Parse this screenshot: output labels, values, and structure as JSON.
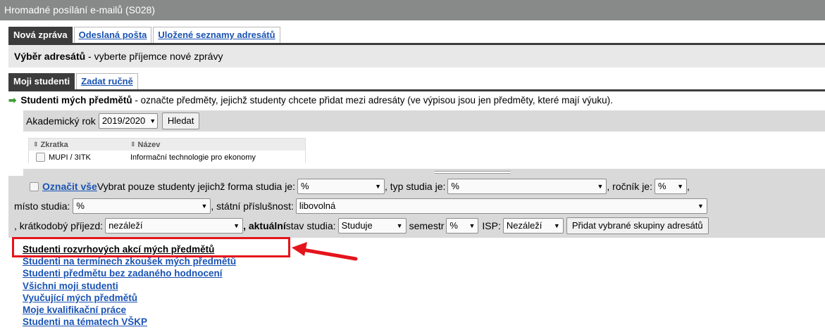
{
  "window": {
    "title": "Hromadné posílání e-mailů (S028)"
  },
  "main_tabs": [
    {
      "label": "Nová zpráva",
      "active": true
    },
    {
      "label": "Odeslaná pošta",
      "active": false
    },
    {
      "label": "Uložené seznamy adresátů",
      "active": false
    }
  ],
  "step": {
    "title": "Výběr adresátů",
    "description": " - vyberte příjemce nové zprávy"
  },
  "sub_tabs": [
    {
      "label": "Moji studenti",
      "active": true
    },
    {
      "label": "Zadat ručně",
      "active": false
    }
  ],
  "section": {
    "icon": "green-arrow-icon",
    "title": "Studenti mých předmětů",
    "description": " - označte předměty, jejichž studenty chcete přidat mezi adresáty (ve výpisou jsou jen předměty, které mají výuku)."
  },
  "academic_year": {
    "label": "Akademický rok",
    "value": "2019/2020",
    "button": "Hledat"
  },
  "subjects_table": {
    "columns": [
      "Zkratka",
      "Název"
    ],
    "rows": [
      {
        "code": "MUPI / 3ITK",
        "name": "Informační technologie pro ekonomy"
      }
    ]
  },
  "filters": {
    "select_all": "Označit vše",
    "text_form": " Vybrat pouze studenty jejichž forma studia je:",
    "form_value": "%",
    "text_type": ", typ studia je:",
    "type_value": "%",
    "text_year": ", ročník je:",
    "year_value": "%",
    "text_year_end": ",",
    "text_place": "místo studia:",
    "place_value": "%",
    "text_citizenship": ", státní příslušnost:",
    "citizenship_value": "libovolná",
    "text_short": ", krátkodobý příjezd:",
    "short_value": "nezáleží",
    "text_current_bold": ", aktuální",
    "text_status": " stav studia:",
    "status_value": "Studuje",
    "text_semester": "semestr",
    "semester_value": "%",
    "text_isp": "ISP:",
    "isp_value": "Nezáleží",
    "add_button": "Přidat vybrané skupiny adresátů"
  },
  "links": [
    "Studenti rozvrhových akcí mých předmětů",
    "Studenti na termínech zkoušek mých předmětů",
    "Studenti předmětu bez zadaného hodnocení",
    "Všichni moji studenti",
    "Vyučující mých předmětů",
    "Moje kvalifikační práce",
    "Studenti na tématech VŠKP"
  ],
  "colors": {
    "highlight": "#e4141b",
    "link": "#1a53b4",
    "active_tab": "#3c3c3c"
  }
}
